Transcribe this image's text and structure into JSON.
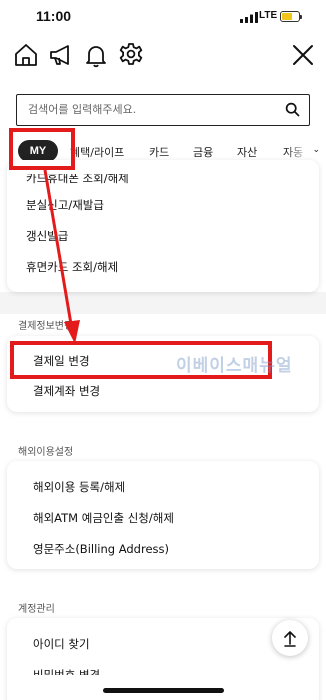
{
  "status_bar": {
    "time": "11:00",
    "network": "LTE",
    "battery_level": 0.65,
    "battery_color": "#f2c51b"
  },
  "top_icons": [
    "home-icon",
    "megaphone-icon",
    "bell-icon",
    "gear-icon",
    "close-icon"
  ],
  "search": {
    "placeholder": "검색어를 입력해주세요."
  },
  "tabs": {
    "active": "MY",
    "items": [
      "혜택/라이프",
      "카드",
      "금융",
      "자산",
      "자동"
    ]
  },
  "menu": {
    "partial_top_item": "카드휴대폰 조회/해제",
    "card_group_1": [
      "분실신고/재발급",
      "갱신발급",
      "휴면카드 조회/해제"
    ],
    "section_payment": "결제정보변경",
    "card_group_2": [
      "결제일 변경",
      "결제계좌 변경"
    ],
    "section_overseas": "해외이용설정",
    "card_group_3": [
      "해외이용 등록/해제",
      "해외ATM 예금인출 신청/해제",
      "영문주소(Billing Address)"
    ],
    "section_account": "계정관리",
    "card_group_4": [
      "아이디 찾기",
      "비밀번호 변경"
    ]
  },
  "annotation": {
    "watermark": "이베이스매뉴얼",
    "highlight_color": "#e31b1b"
  }
}
